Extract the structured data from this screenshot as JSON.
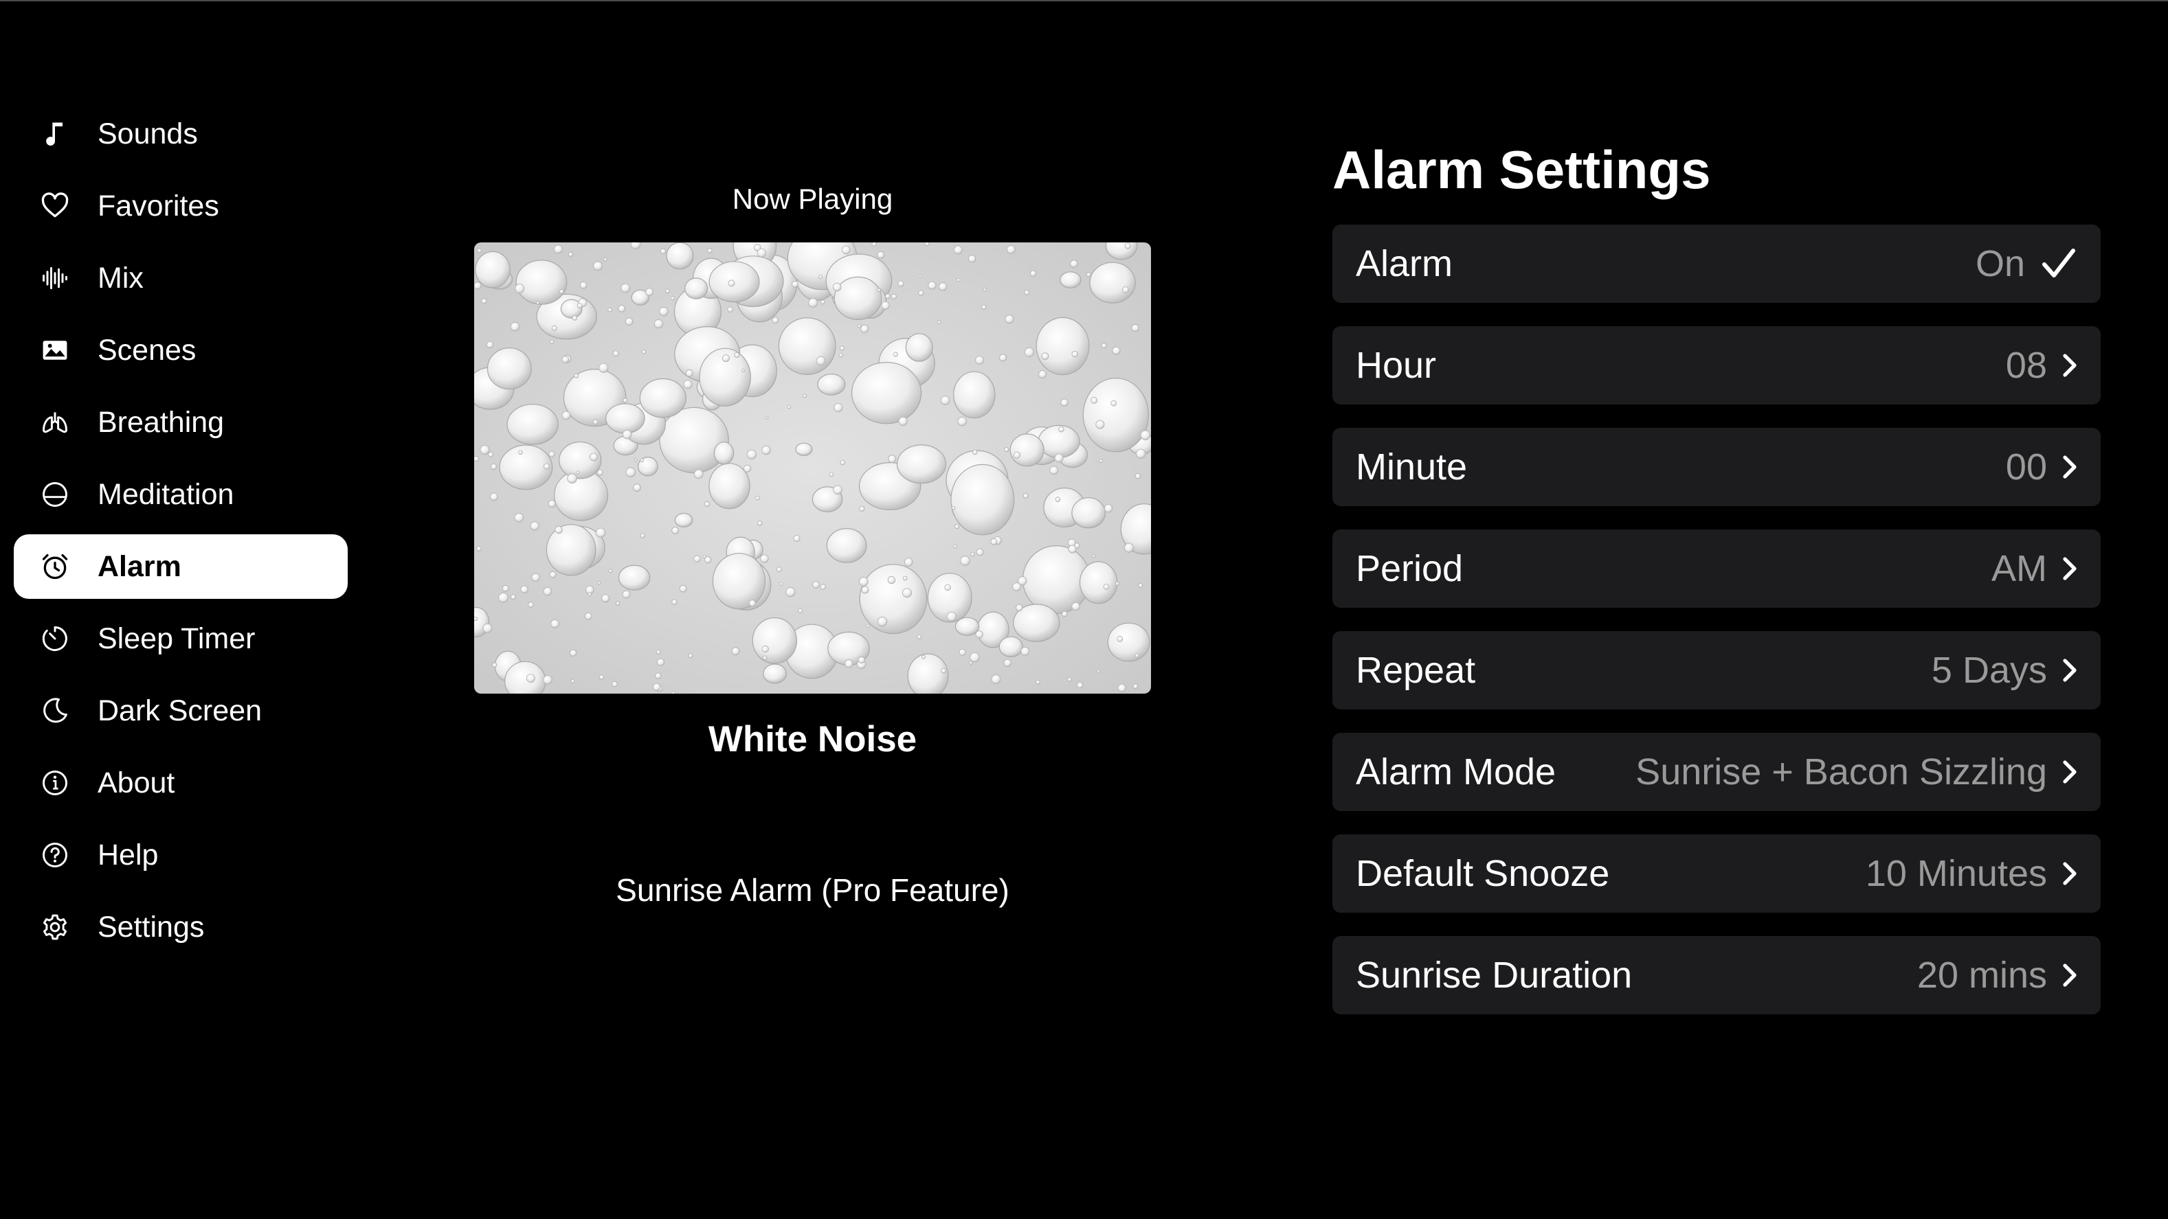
{
  "sidebar": {
    "items": [
      {
        "label": "Sounds",
        "icon": "music-note-icon"
      },
      {
        "label": "Favorites",
        "icon": "heart-icon"
      },
      {
        "label": "Mix",
        "icon": "waveform-icon"
      },
      {
        "label": "Scenes",
        "icon": "photo-icon"
      },
      {
        "label": "Breathing",
        "icon": "lungs-icon"
      },
      {
        "label": "Meditation",
        "icon": "meditation-icon"
      },
      {
        "label": "Alarm",
        "icon": "alarm-clock-icon",
        "active": true
      },
      {
        "label": "Sleep Timer",
        "icon": "timer-icon"
      },
      {
        "label": "Dark Screen",
        "icon": "moon-icon"
      },
      {
        "label": "About",
        "icon": "info-icon"
      },
      {
        "label": "Help",
        "icon": "question-icon"
      },
      {
        "label": "Settings",
        "icon": "gear-icon"
      }
    ]
  },
  "now_playing": {
    "label": "Now Playing",
    "title": "White Noise",
    "artwork": "water-droplets-image",
    "pro_feature": "Sunrise Alarm (Pro Feature)"
  },
  "alarm_settings": {
    "title": "Alarm Settings",
    "rows": [
      {
        "label": "Alarm",
        "value": "On",
        "indicator": "checkmark"
      },
      {
        "label": "Hour",
        "value": "08",
        "indicator": "chevron"
      },
      {
        "label": "Minute",
        "value": "00",
        "indicator": "chevron"
      },
      {
        "label": "Period",
        "value": "AM",
        "indicator": "chevron"
      },
      {
        "label": "Repeat",
        "value": "5 Days",
        "indicator": "chevron"
      },
      {
        "label": "Alarm Mode",
        "value": "Sunrise + Bacon Sizzling",
        "indicator": "chevron"
      },
      {
        "label": "Default Snooze",
        "value": "10 Minutes",
        "indicator": "chevron"
      },
      {
        "label": "Sunrise Duration",
        "value": "20 mins",
        "indicator": "chevron"
      }
    ]
  },
  "colors": {
    "background": "#000000",
    "row_background": "#1c1c1e",
    "value_text": "#9a9a9a",
    "active_nav": "#ffffff"
  }
}
